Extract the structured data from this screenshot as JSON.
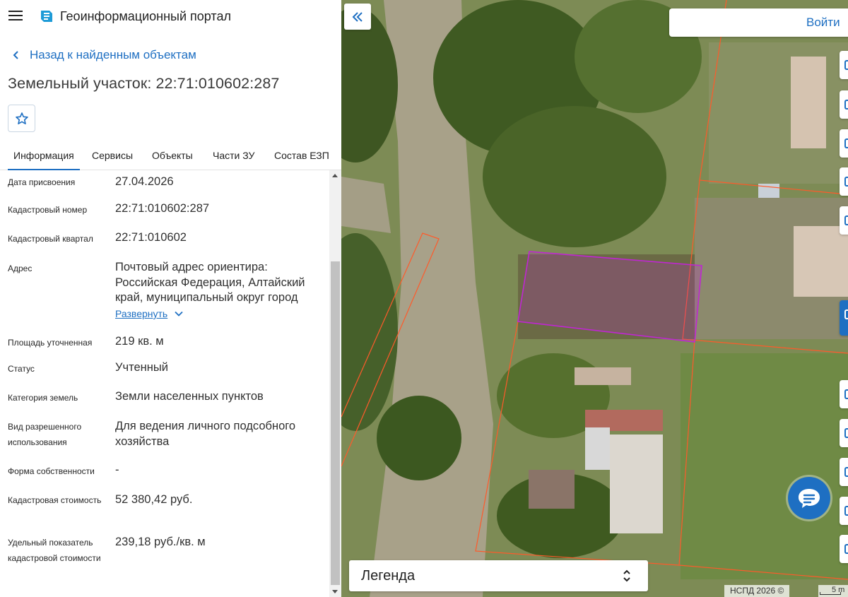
{
  "header": {
    "title": "Геоинформационный портал",
    "menu_icon": "hamburger-icon",
    "logo_icon": "portal-logo-icon"
  },
  "back_link": {
    "label": "Назад к найденным объектам",
    "icon": "chevron-left-icon"
  },
  "object": {
    "title": "Земельный участок: 22:71:010602:287",
    "favorite_icon": "star-outline-icon"
  },
  "tabs": [
    {
      "label": "Информация",
      "active": true
    },
    {
      "label": "Сервисы",
      "active": false
    },
    {
      "label": "Объекты",
      "active": false
    },
    {
      "label": "Части ЗУ",
      "active": false
    },
    {
      "label": "Состав ЕЗП",
      "active": false
    }
  ],
  "info_rows": [
    {
      "label": "Дата присвоения",
      "value": "27.04.2026"
    },
    {
      "label": "Кадастровый номер",
      "value": "22:71:010602:287"
    },
    {
      "label": "Кадастровый квартал",
      "value": "22:71:010602"
    },
    {
      "label": "Адрес",
      "value": "Почтовый адрес ориентира: Российская Федерация, Алтайский край, муниципальный округ город"
    },
    {
      "label": "Площадь уточненная",
      "value": "219 кв. м"
    },
    {
      "label": "Статус",
      "value": "Учтенный"
    },
    {
      "label": "Категория земель",
      "value": "Земли населенных пунктов"
    },
    {
      "label": "Вид разрешенного использования",
      "value": "Для ведения личного подсобного хозяйства"
    },
    {
      "label": "Форма собственности",
      "value": "-"
    },
    {
      "label": "Кадастровая стоимость",
      "value": "52 380,42 руб."
    },
    {
      "label": "Удельный показатель кадастровой стоимости",
      "value": "239,18 руб./кв. м"
    }
  ],
  "expand_link": {
    "label": "Развернуть",
    "icon": "chevron-down-icon"
  },
  "map": {
    "collapse_icon": "double-chevron-left-icon",
    "login_label": "Войти",
    "legend_label": "Легенда",
    "legend_icon": "sort-updown-icon",
    "chat_icon": "chat-icon",
    "attribution": "НСПД 2026 ©",
    "scale_label": "5 m",
    "parcel_color": "#c026d3",
    "boundary_color": "#ff5a2a"
  },
  "colors": {
    "accent": "#1e6fc2",
    "text": "#212121"
  }
}
